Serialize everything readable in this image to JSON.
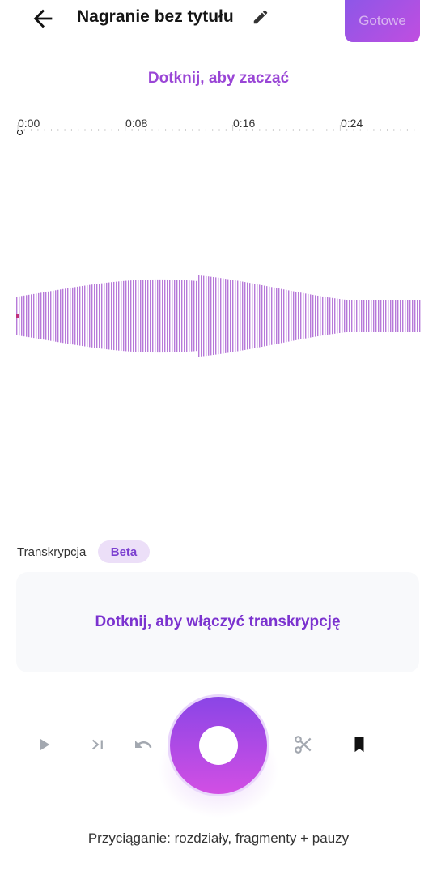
{
  "header": {
    "title": "Nagranie bez tytułu",
    "done_label": "Gotowe",
    "back_icon": "arrow-back-icon",
    "edit_icon": "pencil-icon"
  },
  "prompt": {
    "tap_to_start": "Dotknij, aby zacząć"
  },
  "timeline": {
    "ticks": [
      "0:00",
      "0:08",
      "0:16",
      "0:24"
    ]
  },
  "transcription": {
    "label": "Transkrypcja",
    "badge": "Beta",
    "cta": "Dotknij, aby włączyć transkrypcję"
  },
  "controls": {
    "play_icon": "play-icon",
    "skip_icon": "skip-next-icon",
    "undo_icon": "undo-icon",
    "record_icon": "record-icon",
    "cut_icon": "scissors-icon",
    "bookmark_icon": "bookmark-icon"
  },
  "footer": {
    "snap_info": "Przyciąganie: rozdziały, fragmenty + pauzy"
  },
  "colors": {
    "accent": "#9a46d6",
    "waveform": "#b77ad9",
    "record_gradient_start": "#8a45e6",
    "record_gradient_end": "#d24fe4"
  }
}
